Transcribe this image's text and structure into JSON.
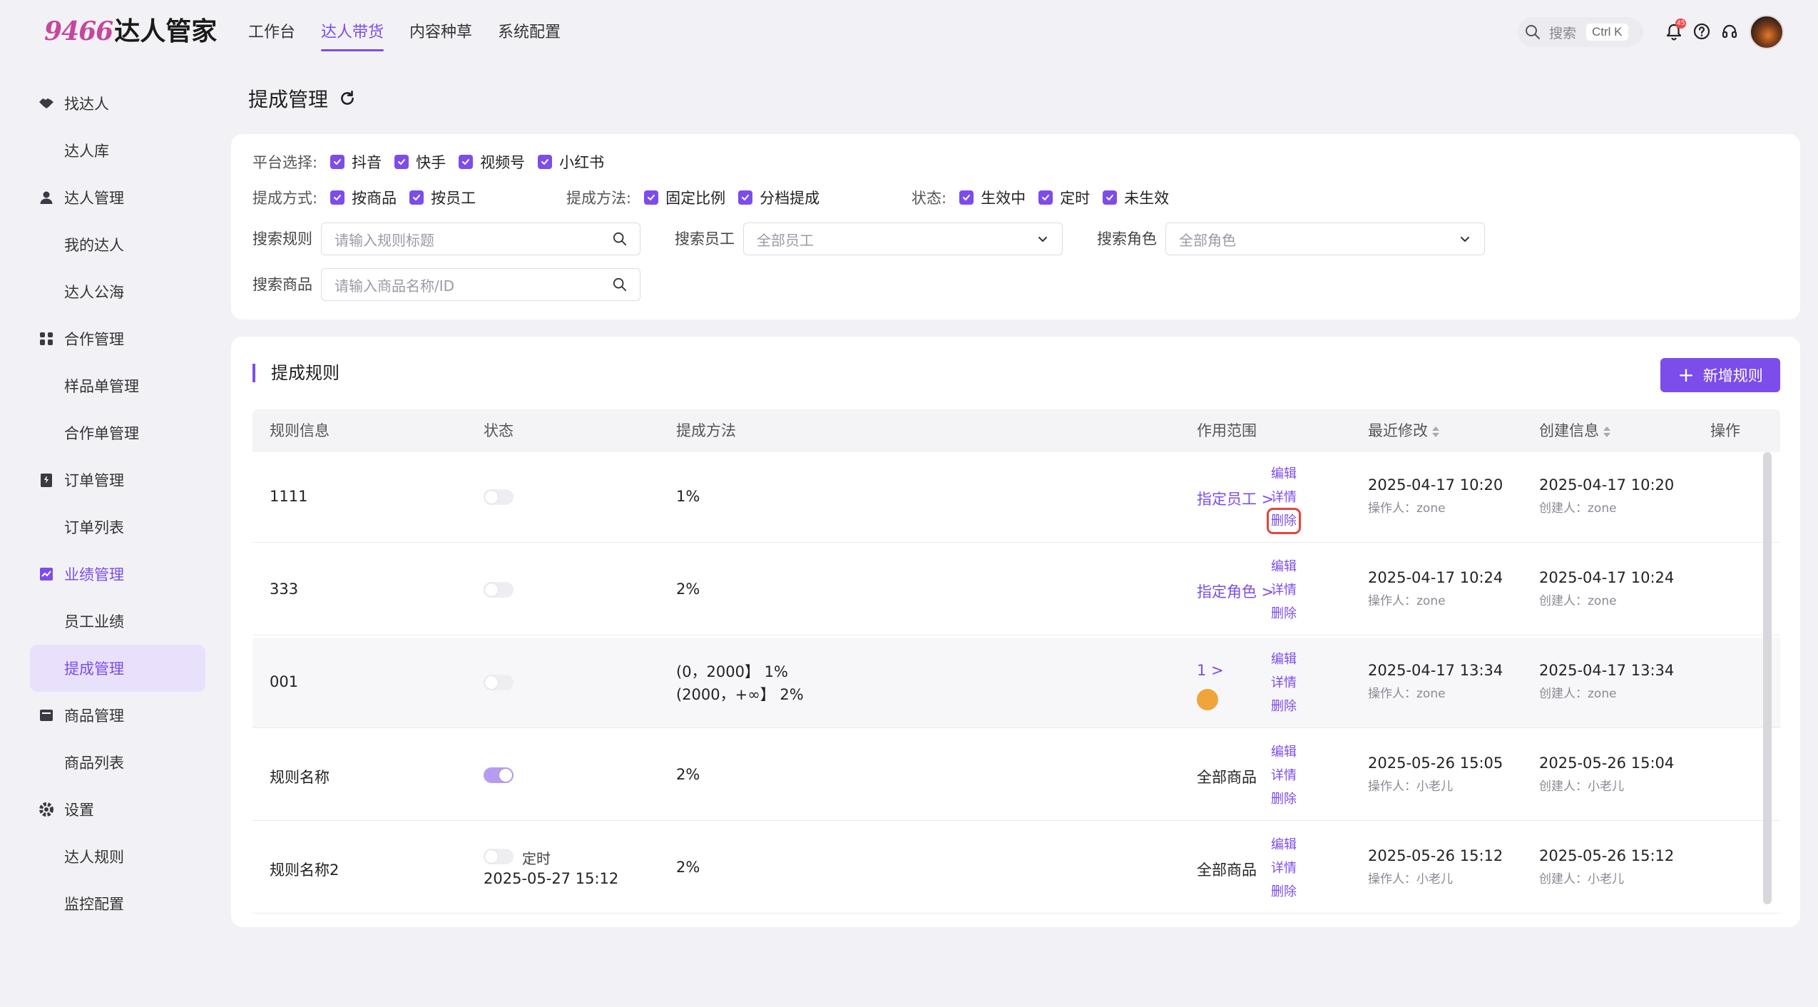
{
  "app": {
    "logo_num": "9466",
    "logo_text": "达人管家"
  },
  "nav": [
    {
      "label": "工作台",
      "active": false
    },
    {
      "label": "达人带货",
      "active": true
    },
    {
      "label": "内容种草",
      "active": false
    },
    {
      "label": "系统配置",
      "active": false
    }
  ],
  "header": {
    "search_placeholder": "搜索",
    "shortcut": "Ctrl K",
    "notif_badge": "45"
  },
  "sidebar": [
    {
      "type": "group",
      "icon": "handshake-icon",
      "label": "找达人"
    },
    {
      "type": "item",
      "label": "达人库"
    },
    {
      "type": "group",
      "icon": "user-icon",
      "label": "达人管理"
    },
    {
      "type": "item",
      "label": "我的达人"
    },
    {
      "type": "item",
      "label": "达人公海"
    },
    {
      "type": "group",
      "icon": "team-icon",
      "label": "合作管理"
    },
    {
      "type": "item",
      "label": "样品单管理"
    },
    {
      "type": "item",
      "label": "合作单管理"
    },
    {
      "type": "group",
      "icon": "order-icon",
      "label": "订单管理"
    },
    {
      "type": "item",
      "label": "订单列表"
    },
    {
      "type": "group",
      "icon": "chart-icon",
      "label": "业绩管理",
      "active": true
    },
    {
      "type": "item",
      "label": "员工业绩"
    },
    {
      "type": "item",
      "label": "提成管理",
      "active": true
    },
    {
      "type": "group",
      "icon": "box-icon",
      "label": "商品管理"
    },
    {
      "type": "item",
      "label": "商品列表"
    },
    {
      "type": "group",
      "icon": "settings-icon",
      "label": "设置"
    },
    {
      "type": "item",
      "label": "达人规则"
    },
    {
      "type": "item",
      "label": "监控配置"
    }
  ],
  "page_title": "提成管理",
  "filters": {
    "platform_label": "平台选择:",
    "platforms": [
      "抖音",
      "快手",
      "视频号",
      "小红书"
    ],
    "mode_label": "提成方式:",
    "modes": [
      "按商品",
      "按员工"
    ],
    "method_label": "提成方法:",
    "methods": [
      "固定比例",
      "分档提成"
    ],
    "status_label": "状态:",
    "statuses": [
      "生效中",
      "定时",
      "未生效"
    ],
    "search_rule_label": "搜索规则",
    "search_rule_placeholder": "请输入规则标题",
    "search_staff_label": "搜索员工",
    "search_staff_value": "全部员工",
    "search_role_label": "搜索角色",
    "search_role_value": "全部角色",
    "search_product_label": "搜索商品",
    "search_product_placeholder": "请输入商品名称/ID"
  },
  "rules": {
    "title": "提成规则",
    "add_button": "新增规则",
    "columns": [
      "规则信息",
      "状态",
      "提成方法",
      "作用范围",
      "最近修改",
      "创建信息",
      "操作"
    ],
    "rows": [
      {
        "name": "1111",
        "toggle_on": false,
        "status_text": "",
        "status_date": "",
        "method": [
          "1%"
        ],
        "scope": "指定员工 >",
        "scope_link": true,
        "modified": "2025-04-17 10:20",
        "modifier": "操作人：zone",
        "created": "2025-04-17 10:20",
        "creator": "创建人：zone",
        "ops": [
          "编辑",
          "详情",
          "删除"
        ]
      },
      {
        "name": "333",
        "toggle_on": false,
        "status_text": "",
        "status_date": "",
        "method": [
          "2%"
        ],
        "scope": "指定角色 >",
        "scope_link": true,
        "modified": "2025-04-17 10:24",
        "modifier": "操作人：zone",
        "created": "2025-04-17 10:24",
        "creator": "创建人：zone",
        "ops": [
          "编辑",
          "详情",
          "删除"
        ]
      },
      {
        "name": "001",
        "toggle_on": false,
        "status_text": "",
        "status_date": "",
        "method": [
          "(0，2000】 1%",
          "(2000，+∞】 2%"
        ],
        "scope": "1 >",
        "scope_link": true,
        "modified": "2025-04-17 13:34",
        "modifier": "操作人：zone",
        "created": "2025-04-17 13:34",
        "creator": "创建人：zone",
        "ops": [
          "编辑",
          "详情",
          "删除"
        ]
      },
      {
        "name": "规则名称",
        "toggle_on": true,
        "status_text": "",
        "status_date": "",
        "method": [
          "2%"
        ],
        "scope": "全部商品",
        "scope_link": false,
        "modified": "2025-05-26 15:05",
        "modifier": "操作人：小老儿",
        "created": "2025-05-26 15:04",
        "creator": "创建人：小老儿",
        "ops": [
          "编辑",
          "详情",
          "删除"
        ]
      },
      {
        "name": "规则名称2",
        "toggle_on": false,
        "status_text": "定时",
        "status_date": "2025-05-27 15:12",
        "method": [
          "2%"
        ],
        "scope": "全部商品",
        "scope_link": false,
        "modified": "2025-05-26 15:12",
        "modifier": "操作人：小老儿",
        "created": "2025-05-26 15:12",
        "creator": "创建人：小老儿",
        "ops": [
          "编辑",
          "详情",
          "删除"
        ]
      }
    ]
  }
}
